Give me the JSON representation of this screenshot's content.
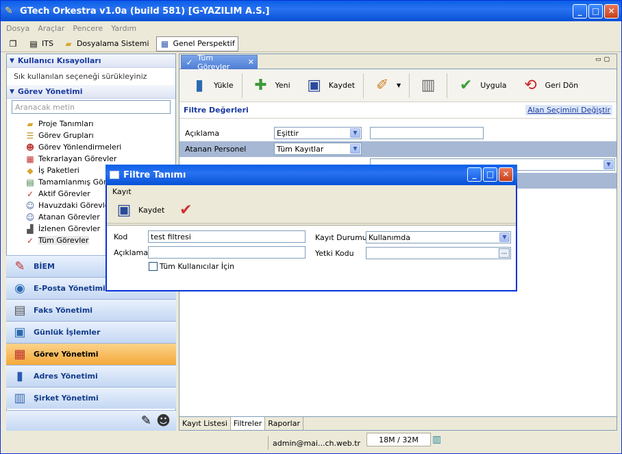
{
  "window": {
    "title": "GTech Orkestra v1.0a (build 581) [G-YAZILIM A.S.]",
    "min": "_",
    "max": "□",
    "close": "✕"
  },
  "menu": [
    "Dosya",
    "Araçlar",
    "Pencere",
    "Yardım"
  ],
  "toolbar": {
    "its": "ITS",
    "dosyalama": "Dosyalama Sistemi",
    "perspektif": "Genel Perspektif"
  },
  "sidebar": {
    "shortcuts_title": "Kullanıcı Kısayolları",
    "shortcuts_hint": "Sık kullanılan seçeneği sürükleyiniz",
    "tasks_title": "Görev Yönetimi",
    "search_placeholder": "Aranacak metin",
    "items": [
      "Proje Tanımları",
      "Görev Grupları",
      "Görev Yönlendirmeleri",
      "Tekrarlayan Görevler",
      "İş Paketleri",
      "Tamamlanmış Görevler",
      "Aktif Görevler",
      "Havuzdaki Görevler",
      "Atanan Görevler",
      "İzlenen Görevler",
      "Tüm Görevler"
    ],
    "accordion": [
      "BİEM",
      "E-Posta Yönetimi",
      "Faks Yönetimi",
      "Günlük İşlemler",
      "Görev Yönetimi",
      "Adres Yönetimi",
      "Şirket Yönetimi"
    ]
  },
  "main": {
    "tab": "Tüm Görevler",
    "toolbar": {
      "yukle": "Yükle",
      "yeni": "Yeni",
      "kaydet": "Kaydet",
      "uygula": "Uygula",
      "geri_don": "Geri Dön"
    },
    "filter_title": "Filtre Değerleri",
    "filter_link": "Alan Seçimini Değiştir",
    "rows": [
      {
        "label": "Açıklama",
        "op": "Eşittir"
      },
      {
        "label": "Atanan Personel",
        "op": "Tüm Kayıtlar"
      }
    ],
    "bottom_tabs": [
      "Kayıt Listesi",
      "Filtreler",
      "Raporlar"
    ]
  },
  "dialog": {
    "title": "Filtre Tanımı",
    "menu": "Kayıt",
    "kaydet": "Kaydet",
    "kod_label": "Kod",
    "kod_value": "test filtresi",
    "aciklama_label": "Açıklama",
    "tum_kullanicilar": "Tüm Kullanıcılar İçin",
    "kayit_durumu_label": "Kayıt Durumu",
    "kayit_durumu_value": "Kullanımda",
    "yetki_kodu_label": "Yetki Kodu",
    "browse": "..."
  },
  "status": {
    "user": "admin@mai...ch.web.tr",
    "memory": "18M / 32M"
  }
}
